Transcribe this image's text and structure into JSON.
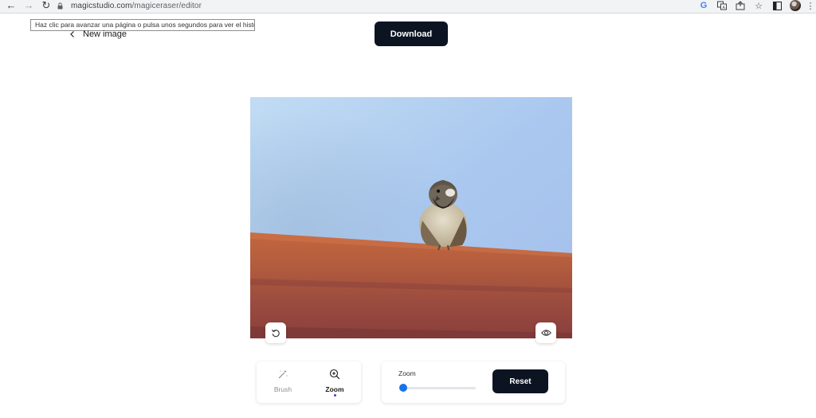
{
  "browser": {
    "url_domain": "magicstudio.com",
    "url_path": "/magiceraser/editor",
    "back_icon": "arrow-left-icon",
    "forward_icon": "arrow-right-icon",
    "reload_icon": "reload-icon",
    "lock_icon": "lock-icon",
    "right_icons": [
      "google-icon",
      "translate-icon",
      "share-icon",
      "star-icon",
      "side-panel-icon",
      "avatar",
      "more-vert-icon"
    ]
  },
  "tooltip": {
    "text": "Haz clic para avanzar una página o pulsa unos segundos para ver el historial"
  },
  "header": {
    "back_label": "New image",
    "download_label": "Download"
  },
  "editor": {
    "undo_icon": "undo-icon",
    "preview_icon": "eye-icon"
  },
  "tools": {
    "brush_label": "Brush",
    "zoom_label": "Zoom",
    "active_tool": "Zoom"
  },
  "zoom": {
    "label": "Zoom",
    "slider_value": 0.0,
    "reset_label": "Reset"
  },
  "colors": {
    "primary_button": "#0c1422",
    "slider_accent": "#1a73e8",
    "active_indicator": "#6c2bd9"
  }
}
